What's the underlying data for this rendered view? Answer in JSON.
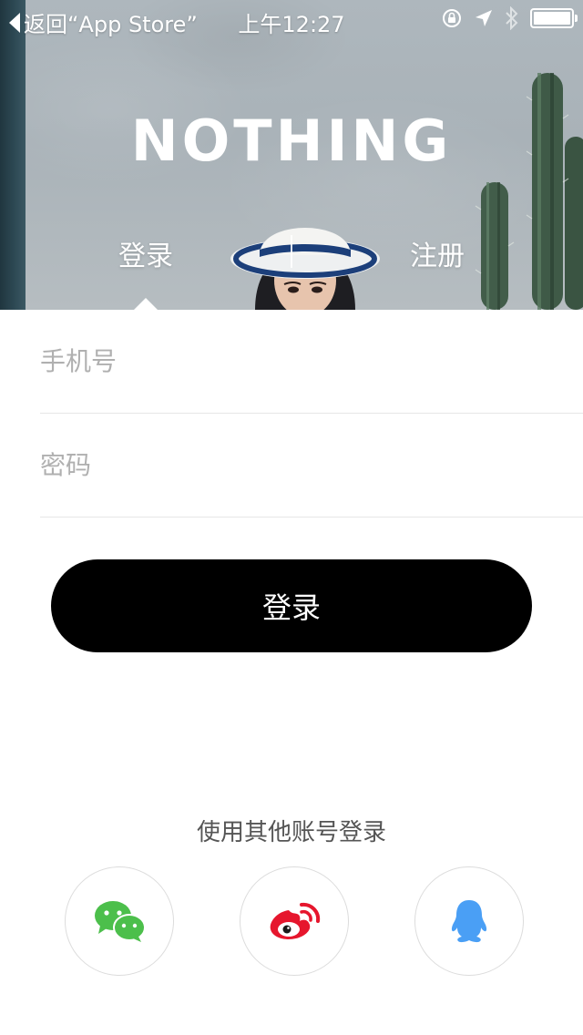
{
  "status_bar": {
    "back_label": "返回“App Store”",
    "time": "上午12:27",
    "battery_level": 1.0
  },
  "hero": {
    "brand": "NOTHING",
    "tabs": [
      {
        "label": "登录",
        "active": true
      },
      {
        "label": "注册",
        "active": false
      }
    ]
  },
  "form": {
    "phone_placeholder": "手机号",
    "password_placeholder": "密码",
    "login_button": "登录"
  },
  "social": {
    "label": "使用其他账号登录",
    "providers": [
      {
        "name": "wechat",
        "icon": "wechat-icon",
        "color": "#4cbf4b"
      },
      {
        "name": "weibo",
        "icon": "weibo-icon",
        "color": "#e6162d"
      },
      {
        "name": "qq",
        "icon": "qq-icon",
        "color": "#4a9ff5"
      }
    ]
  },
  "colors": {
    "button_background": "#000000",
    "placeholder": "#b0b0b0",
    "divider": "#e6e6e6"
  }
}
